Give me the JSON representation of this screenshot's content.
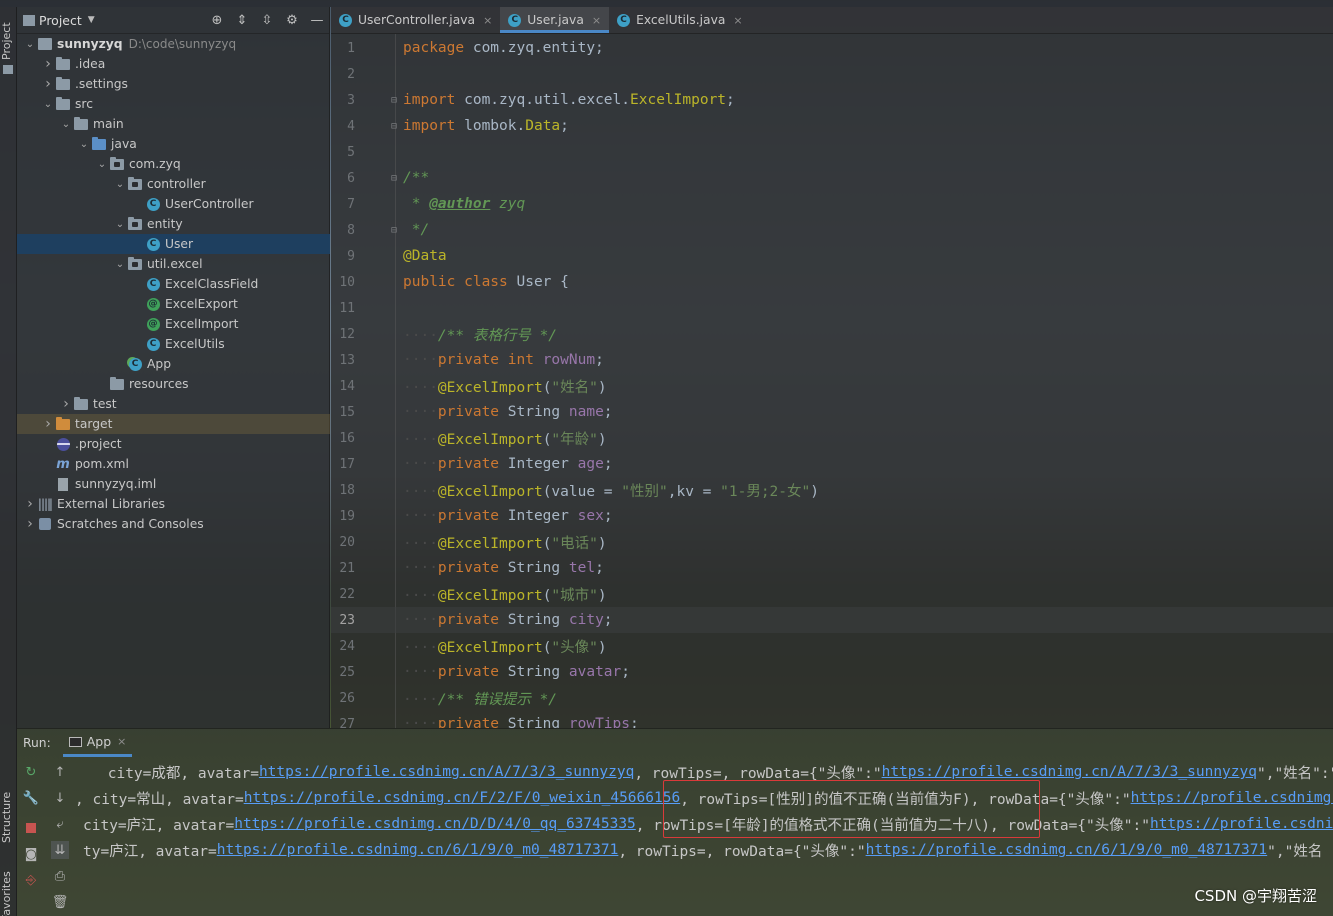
{
  "window": {
    "top_strip": ""
  },
  "left_stripe": {
    "project_label": "Project",
    "structure_label": "Structure",
    "favorites_label": "Favorites"
  },
  "project_panel": {
    "title": "Project",
    "tree": [
      {
        "label": "sunnyzyq",
        "extra": "D:\\code\\sunnyzyq",
        "depth": 0,
        "arrow": "down",
        "icon": "project-folder-icon"
      },
      {
        "label": ".idea",
        "depth": 1,
        "arrow": "right",
        "icon": "folder-icon"
      },
      {
        "label": ".settings",
        "depth": 1,
        "arrow": "right",
        "icon": "folder-icon"
      },
      {
        "label": "src",
        "depth": 1,
        "arrow": "down",
        "icon": "folder-icon"
      },
      {
        "label": "main",
        "depth": 2,
        "arrow": "down",
        "icon": "folder-icon"
      },
      {
        "label": "java",
        "depth": 3,
        "arrow": "down",
        "icon": "source-folder-icon"
      },
      {
        "label": "com.zyq",
        "depth": 4,
        "arrow": "down",
        "icon": "package-icon"
      },
      {
        "label": "controller",
        "depth": 5,
        "arrow": "down",
        "icon": "package-icon"
      },
      {
        "label": "UserController",
        "depth": 6,
        "arrow": "",
        "icon": "class-icon"
      },
      {
        "label": "entity",
        "depth": 5,
        "arrow": "down",
        "icon": "package-icon"
      },
      {
        "label": "User",
        "depth": 6,
        "arrow": "",
        "icon": "class-icon",
        "selected": true
      },
      {
        "label": "util.excel",
        "depth": 5,
        "arrow": "down",
        "icon": "package-icon"
      },
      {
        "label": "ExcelClassField",
        "depth": 6,
        "arrow": "",
        "icon": "class-icon"
      },
      {
        "label": "ExcelExport",
        "depth": 6,
        "arrow": "",
        "icon": "annotation-icon"
      },
      {
        "label": "ExcelImport",
        "depth": 6,
        "arrow": "",
        "icon": "annotation-icon"
      },
      {
        "label": "ExcelUtils",
        "depth": 6,
        "arrow": "",
        "icon": "class-icon"
      },
      {
        "label": "App",
        "depth": 5,
        "arrow": "",
        "icon": "app-class-icon"
      },
      {
        "label": "resources",
        "depth": 4,
        "arrow": "",
        "icon": "resources-folder-icon"
      },
      {
        "label": "test",
        "depth": 2,
        "arrow": "right",
        "icon": "folder-icon"
      },
      {
        "label": "target",
        "depth": 1,
        "arrow": "right",
        "icon": "excluded-folder-icon",
        "highlight": true
      },
      {
        "label": ".project",
        "depth": 1,
        "arrow": "",
        "icon": "eclipse-file-icon"
      },
      {
        "label": "pom.xml",
        "depth": 1,
        "arrow": "",
        "icon": "maven-icon"
      },
      {
        "label": "sunnyzyq.iml",
        "depth": 1,
        "arrow": "",
        "icon": "iml-file-icon"
      },
      {
        "label": "External Libraries",
        "depth": 0,
        "arrow": "right",
        "icon": "libraries-icon"
      },
      {
        "label": "Scratches and Consoles",
        "depth": 0,
        "arrow": "right",
        "icon": "scratches-icon"
      }
    ]
  },
  "editor": {
    "tabs": [
      {
        "label": "UserController.java",
        "active": false
      },
      {
        "label": "User.java",
        "active": true
      },
      {
        "label": "ExcelUtils.java",
        "active": false
      }
    ],
    "current_line": 23,
    "lines": [
      {
        "n": "1",
        "fold": "",
        "html": "<span class='kw'>package</span> com.zyq.entity;"
      },
      {
        "n": "2",
        "fold": "",
        "html": ""
      },
      {
        "n": "3",
        "fold": "⊟",
        "html": "<span class='kw'>import</span> com.zyq.util.excel.<span class='ann'>ExcelImport</span>;"
      },
      {
        "n": "4",
        "fold": "⊟",
        "html": "<span class='kw'>import</span> lombok.<span class='ann'>Data</span>;"
      },
      {
        "n": "5",
        "fold": "",
        "html": ""
      },
      {
        "n": "6",
        "fold": "⊟",
        "html": "<span class='cmt'>/**</span>"
      },
      {
        "n": "7",
        "fold": "",
        "html": "<span class='cmt'> * </span><span class='cmt-tag'>@author</span><span class='cmt'> zyq</span>"
      },
      {
        "n": "8",
        "fold": "⊟",
        "html": "<span class='cmt'> */</span>"
      },
      {
        "n": "9",
        "fold": "",
        "html": "<span class='ann'>@Data</span>"
      },
      {
        "n": "10",
        "fold": "",
        "html": "<span class='kw'>public class</span> User {"
      },
      {
        "n": "11",
        "fold": "",
        "html": ""
      },
      {
        "n": "12",
        "fold": "",
        "html": "<span class='dots'>····</span><span class='cmt'>/** 表格行号 */</span>"
      },
      {
        "n": "13",
        "fold": "",
        "html": "<span class='dots'>····</span><span class='kw'>private int</span> <span class='fld'>rowNum</span>;"
      },
      {
        "n": "14",
        "fold": "",
        "html": "<span class='dots'>····</span><span class='ann'>@ExcelImport</span>(<span class='str'>\"姓名\"</span>)"
      },
      {
        "n": "15",
        "fold": "",
        "html": "<span class='dots'>····</span><span class='kw'>private</span> String <span class='fld'>name</span>;"
      },
      {
        "n": "16",
        "fold": "",
        "html": "<span class='dots'>····</span><span class='ann'>@ExcelImport</span>(<span class='str'>\"年龄\"</span>)"
      },
      {
        "n": "17",
        "fold": "",
        "html": "<span class='dots'>····</span><span class='kw'>private</span> Integer <span class='fld'>age</span>;"
      },
      {
        "n": "18",
        "fold": "",
        "html": "<span class='dots'>····</span><span class='ann'>@ExcelImport</span>(value = <span class='str'>\"性别\"</span>,kv = <span class='str'>\"1-男;2-女\"</span>)"
      },
      {
        "n": "19",
        "fold": "",
        "html": "<span class='dots'>····</span><span class='kw'>private</span> Integer <span class='fld'>sex</span>;"
      },
      {
        "n": "20",
        "fold": "",
        "html": "<span class='dots'>····</span><span class='ann'>@ExcelImport</span>(<span class='str'>\"电话\"</span>)"
      },
      {
        "n": "21",
        "fold": "",
        "html": "<span class='dots'>····</span><span class='kw'>private</span> String <span class='fld'>tel</span>;"
      },
      {
        "n": "22",
        "fold": "",
        "html": "<span class='dots'>····</span><span class='ann'>@ExcelImport</span>(<span class='str'>\"城市\"</span>)"
      },
      {
        "n": "23",
        "fold": "",
        "html": "<span class='dots'>····</span><span class='kw'>private</span> String <span class='fld'>city</span>;"
      },
      {
        "n": "24",
        "fold": "",
        "html": "<span class='dots'>····</span><span class='ann'>@ExcelImport</span>(<span class='str'>\"头像\"</span>)"
      },
      {
        "n": "25",
        "fold": "",
        "html": "<span class='dots'>····</span><span class='kw'>private</span> String <span class='fld'>avatar</span>;"
      },
      {
        "n": "26",
        "fold": "",
        "html": "<span class='dots'>····</span><span class='cmt'>/** 错误提示 */</span>"
      },
      {
        "n": "27",
        "fold": "",
        "html": "<span class='dots'>····</span><span class='kw'>private</span> String <span class='fld'>rowTips</span>;"
      }
    ]
  },
  "run_panel": {
    "label": "Run:",
    "tab": "App",
    "console": [
      [
        {
          "t": " city=成都, avatar="
        },
        {
          "t": "https://profile.csdnimg.cn/A/7/3/3_sunnyzyq",
          "link": true
        },
        {
          "t": ", rowTips=, rowData={\"头像\":\""
        },
        {
          "t": "https://profile.csdnimg.cn/A/7/3/3_sunnyzyq",
          "link": true
        },
        {
          "t": "\",\"姓名\":\"张"
        }
      ],
      [
        {
          "t": ", city=常山, avatar="
        },
        {
          "t": "https://profile.csdnimg.cn/F/2/F/0_weixin_45666156",
          "link": true
        },
        {
          "t": ", rowTips=[性别]的值不正确(当前值为F), rowData={\"头像\":\""
        },
        {
          "t": "https://profile.csdnimg.cn/F",
          "link": true
        }
      ],
      [
        {
          "t": "city=庐江, avatar="
        },
        {
          "t": "https://profile.csdnimg.cn/D/D/4/0_qq_63745335",
          "link": true
        },
        {
          "t": ", rowTips=[年龄]的值格式不正确(当前值为二十八), rowData={\"头像\":\""
        },
        {
          "t": "https://profile.csdnimg.cn/D",
          "link": true
        }
      ],
      [
        {
          "t": "ty=庐江, avatar="
        },
        {
          "t": "https://profile.csdnimg.cn/6/1/9/0_m0_48717371",
          "link": true
        },
        {
          "t": ", rowTips=, rowData={\"头像\":\""
        },
        {
          "t": "https://profile.csdnimg.cn/6/1/9/0_m0_48717371",
          "link": true
        },
        {
          "t": "\",\"姓名"
        }
      ]
    ]
  },
  "watermark": "CSDN @宇翔苦涩",
  "colors": {
    "selection": "#1e3f5f",
    "tab_underline": "#4a88c7",
    "keyword": "#cc7832",
    "annotation": "#bbb529",
    "string": "#6a8759",
    "field": "#9876aa",
    "comment": "#629755",
    "link": "#589df6",
    "highlight_box": "#d93a3a"
  }
}
